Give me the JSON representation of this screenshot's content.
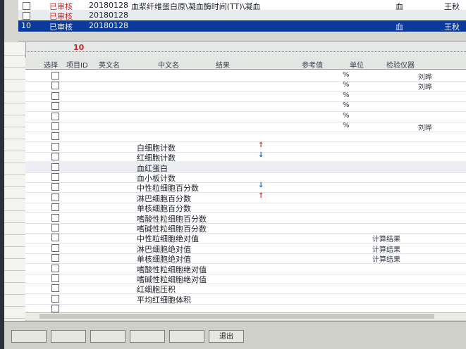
{
  "top_list": [
    {
      "status": "已审核",
      "date": "20180128",
      "desc": "血浆纤维蛋白原\\凝血酶时间(TT)\\凝血",
      "unit": "血",
      "name": "王秋"
    },
    {
      "status": "已审核",
      "date": "20180128",
      "desc": "",
      "unit": "",
      "name": ""
    },
    {
      "id": "10",
      "status": "已审核",
      "date": "20180128",
      "desc": "",
      "unit": "血",
      "name": "王秋"
    }
  ],
  "marker": "10",
  "left_strip": [
    "",
    "",
    "",
    "",
    "",
    "",
    "",
    "",
    "",
    "",
    "",
    "",
    "",
    "",
    "",
    "",
    "",
    "",
    "",
    "",
    "",
    "",
    ""
  ],
  "headers": {
    "flag": "选择",
    "id": "项目ID",
    "en": "英文名",
    "cn": "中文名",
    "result": "结果",
    "ref": "参考值",
    "unit": "单位",
    "instrument": "检验仪器",
    "tester": "",
    "dev": ""
  },
  "colors": {
    "high": "#d32f2f",
    "low": "#1565c0",
    "selection": "#0a3b9c"
  },
  "rows": [
    {
      "no": "",
      "id": "",
      "en": "",
      "cn": "",
      "result": "",
      "flag": "",
      "ref": "",
      "unit": "%",
      "inst": "",
      "tester": "刘晔",
      "dev": ""
    },
    {
      "no": "",
      "id": "",
      "en": "",
      "cn": "",
      "result": "",
      "flag": "",
      "ref": "",
      "unit": "%",
      "inst": "",
      "tester": "刘晔",
      "dev": ""
    },
    {
      "no": "",
      "id": "",
      "en": "",
      "cn": "",
      "result": "",
      "flag": "",
      "ref": "",
      "unit": "%",
      "inst": "",
      "tester": "",
      "dev": ""
    },
    {
      "no": "",
      "id": "",
      "en": "",
      "cn": "",
      "result": "",
      "flag": "",
      "ref": "",
      "unit": "%",
      "inst": "",
      "tester": "",
      "dev": ""
    },
    {
      "no": "",
      "id": "",
      "en": "",
      "cn": "",
      "result": "",
      "flag": "",
      "ref": "",
      "unit": "%",
      "inst": "",
      "tester": "",
      "dev": ""
    },
    {
      "no": "",
      "id": "",
      "en": "",
      "cn": "",
      "result": "",
      "flag": "",
      "ref": "",
      "unit": "%",
      "inst": "",
      "tester": "刘晔",
      "dev": ""
    },
    {
      "no": "",
      "id": "",
      "en": "",
      "cn": "",
      "result": "",
      "flag": "",
      "ref": "",
      "unit": "",
      "inst": "",
      "tester": "",
      "dev": ""
    },
    {
      "no": "",
      "id": "",
      "en": "",
      "cn": "白细胞计数",
      "result": "",
      "flag": "high",
      "ref": "",
      "unit": "",
      "inst": "",
      "tester": "",
      "dev": ""
    },
    {
      "no": "",
      "id": "",
      "en": "",
      "cn": "红细胞计数",
      "result": "",
      "flag": "low",
      "ref": "",
      "unit": "",
      "inst": "",
      "tester": "",
      "dev": ""
    },
    {
      "no": "",
      "id": "",
      "en": "",
      "cn": "血红蛋白",
      "result": "",
      "flag": "",
      "ref": "",
      "unit": "",
      "inst": "",
      "tester": "",
      "dev": ""
    },
    {
      "no": "",
      "id": "",
      "en": "",
      "cn": "血小板计数",
      "result": "",
      "flag": "",
      "ref": "",
      "unit": "",
      "inst": "",
      "tester": "",
      "dev": ""
    },
    {
      "no": "",
      "id": "",
      "en": "",
      "cn": "中性粒细胞百分数",
      "result": "",
      "flag": "low",
      "ref": "",
      "unit": "",
      "inst": "",
      "tester": "",
      "dev": ""
    },
    {
      "no": "",
      "id": "",
      "en": "",
      "cn": "淋巴细胞百分数",
      "result": "",
      "flag": "high",
      "ref": "",
      "unit": "",
      "inst": "",
      "tester": "",
      "dev": ""
    },
    {
      "no": "",
      "id": "",
      "en": "",
      "cn": "单核细胞百分数",
      "result": "",
      "flag": "",
      "ref": "",
      "unit": "",
      "inst": "",
      "tester": "",
      "dev": ""
    },
    {
      "no": "",
      "id": "",
      "en": "",
      "cn": "嗜酸性粒细胞百分数",
      "result": "",
      "flag": "",
      "ref": "",
      "unit": "",
      "inst": "",
      "tester": "",
      "dev": ""
    },
    {
      "no": "",
      "id": "",
      "en": "",
      "cn": "嗜碱性粒细胞百分数",
      "result": "",
      "flag": "",
      "ref": "",
      "unit": "",
      "inst": "",
      "tester": "",
      "dev": ""
    },
    {
      "no": "",
      "id": "",
      "en": "",
      "cn": "中性粒细胞绝对值",
      "result": "",
      "flag": "",
      "ref": "",
      "unit": "",
      "inst": "计算结果",
      "tester": "",
      "dev": ""
    },
    {
      "no": "",
      "id": "",
      "en": "",
      "cn": "淋巴细胞绝对值",
      "result": "",
      "flag": "",
      "ref": "",
      "unit": "",
      "inst": "计算结果",
      "tester": "",
      "dev": ""
    },
    {
      "no": "",
      "id": "",
      "en": "",
      "cn": "单核细胞绝对值",
      "result": "",
      "flag": "",
      "ref": "",
      "unit": "",
      "inst": "计算结果",
      "tester": "",
      "dev": ""
    },
    {
      "no": "",
      "id": "",
      "en": "",
      "cn": "嗜酸性粒细胞绝对值",
      "result": "",
      "flag": "",
      "ref": "",
      "unit": "",
      "inst": "",
      "tester": "",
      "dev": ""
    },
    {
      "no": "",
      "id": "",
      "en": "",
      "cn": "嗜碱性粒细胞绝对值",
      "result": "",
      "flag": "",
      "ref": "",
      "unit": "",
      "inst": "",
      "tester": "",
      "dev": ""
    },
    {
      "no": "",
      "id": "",
      "en": "",
      "cn": "红细胞压积",
      "result": "",
      "flag": "",
      "ref": "",
      "unit": "",
      "inst": "",
      "tester": "",
      "dev": ""
    },
    {
      "no": "",
      "id": "",
      "en": "",
      "cn": "平均红细胞体积",
      "result": "",
      "flag": "",
      "ref": "",
      "unit": "",
      "inst": "",
      "tester": "",
      "dev": ""
    },
    {
      "no": "",
      "id": "",
      "en": "",
      "cn": "",
      "result": "",
      "flag": "",
      "ref": "",
      "unit": "",
      "inst": "",
      "tester": "",
      "dev": ""
    }
  ],
  "buttons": [
    "",
    "",
    "",
    "",
    "",
    "退出"
  ]
}
